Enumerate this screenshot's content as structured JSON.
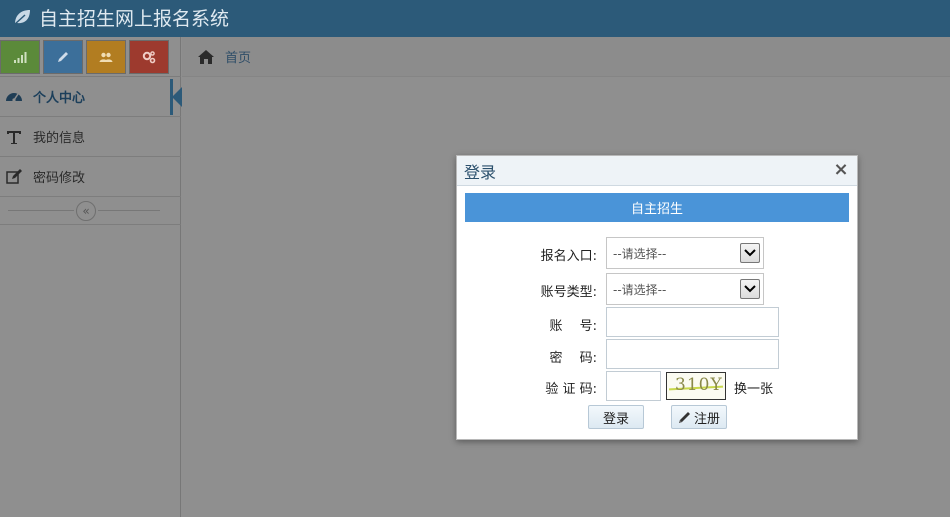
{
  "app": {
    "title": "自主招生网上报名系统",
    "logo_icon": "leaf-icon"
  },
  "shortcuts": [
    {
      "name": "signal-icon",
      "color": "#5b8a3a"
    },
    {
      "name": "pencil-icon",
      "color": "#3c6f9a"
    },
    {
      "name": "users-icon",
      "color": "#b27d21"
    },
    {
      "name": "cogs-icon",
      "color": "#9d3a2e"
    }
  ],
  "sidebar": {
    "items": [
      {
        "label": "个人中心",
        "icon": "dashboard-icon",
        "active": true
      },
      {
        "label": "我的信息",
        "icon": "text-icon",
        "active": false
      },
      {
        "label": "密码修改",
        "icon": "edit-icon",
        "active": false
      }
    ],
    "collapse_glyph": "«"
  },
  "breadcrumb": {
    "home_label": "首页",
    "icon": "home-icon"
  },
  "modal": {
    "title": "登录",
    "close_glyph": "×",
    "banner": "自主招生",
    "fields": {
      "entry_label": "报名入口:",
      "entry_value": "--请选择--",
      "account_type_label": "账号类型:",
      "account_type_value": "--请选择--",
      "account_label": "账　 号:",
      "password_label": "密　 码:",
      "captcha_label": "验 证 码:"
    },
    "captcha_text": "310Y",
    "change_captcha": "换一张",
    "login_button": "登录",
    "register_button": "注册"
  }
}
